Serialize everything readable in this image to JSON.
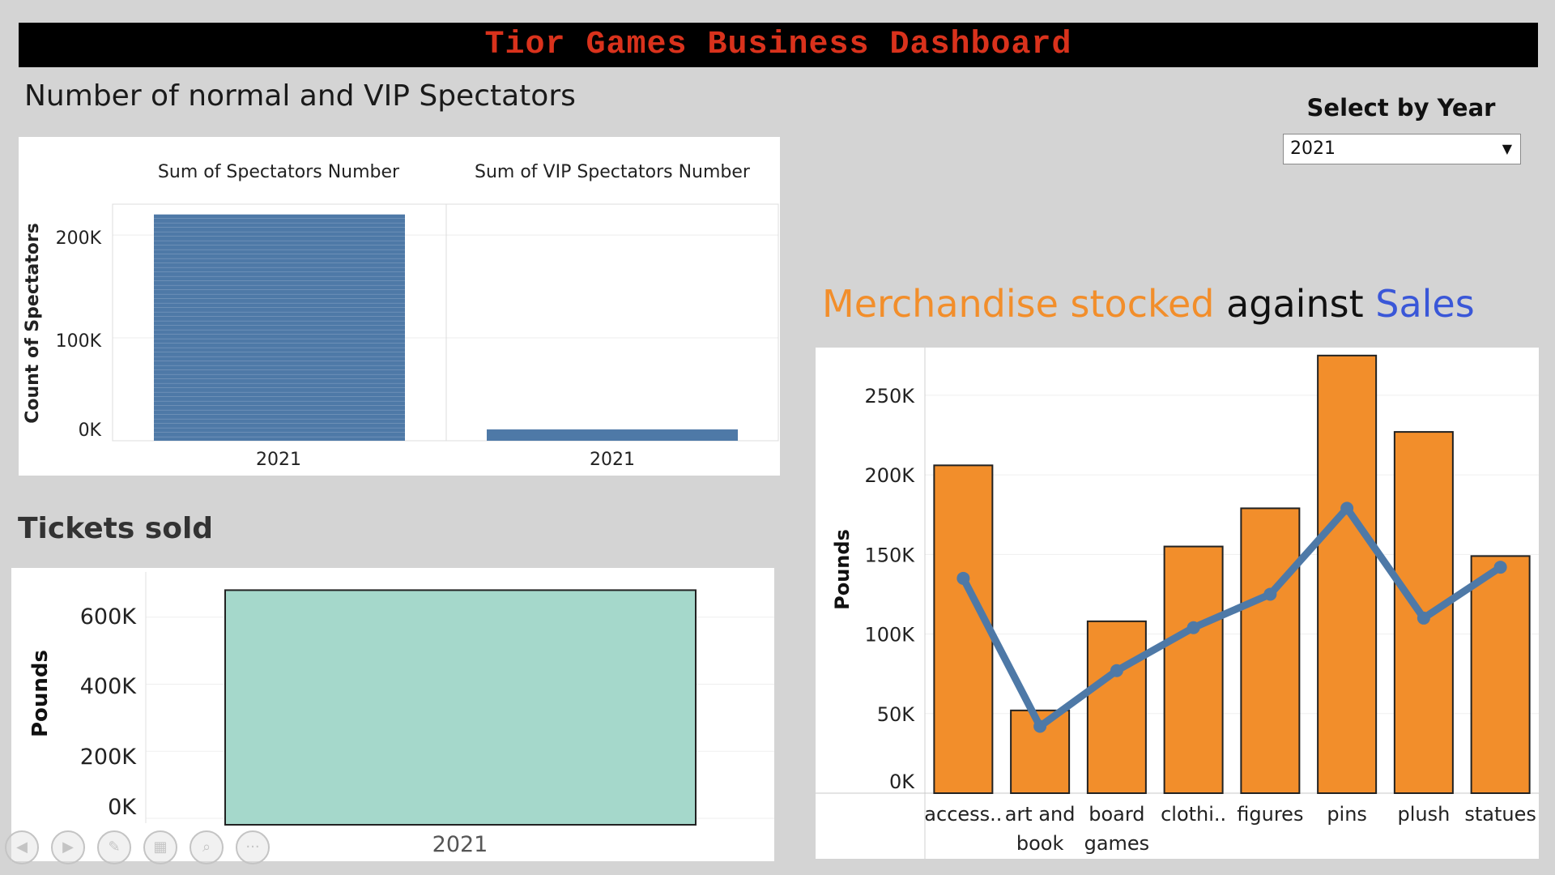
{
  "title": "Tior Games Business Dashboard",
  "spectators": {
    "section_title": "Number of normal and VIP Spectators",
    "y_axis_label": "Count of Spectators"
  },
  "tickets": {
    "section_title": "Tickets sold",
    "y_axis_label": "Pounds"
  },
  "merch": {
    "title_part1": "Merchandise stocked",
    "title_part2": " against ",
    "title_part3": "Sales",
    "y_axis_label": "Pounds"
  },
  "year_filter": {
    "label": "Select by Year",
    "selected": "2021"
  },
  "colors": {
    "title_red": "#d9321c",
    "spectators_bar": "#4e79a7",
    "tickets_bar": "#a5d8cb",
    "merch_stock": "#f28e2b",
    "merch_sales_line": "#4e79a7",
    "title_orange": "#f28e2b",
    "title_blue": "#3a57d8"
  },
  "toolbar_icons": [
    "back-icon",
    "forward-icon",
    "pen-icon",
    "layout-icon",
    "zoom-icon",
    "more-icon"
  ],
  "chart_data": [
    {
      "type": "bar",
      "name": "spectators",
      "panels": [
        "Sum of Spectators Number",
        "Sum of VIP Spectators Number"
      ],
      "categories": [
        "2021"
      ],
      "series": [
        {
          "name": "Sum of Spectators Number",
          "values": [
            220000
          ]
        },
        {
          "name": "Sum of VIP Spectators Number",
          "values": [
            11000
          ]
        }
      ],
      "ylabel": "Count of Spectators",
      "yticks": [
        "200K",
        "100K",
        "0K"
      ],
      "ylim": [
        0,
        230000
      ]
    },
    {
      "type": "bar",
      "name": "tickets",
      "categories": [
        "2021"
      ],
      "values": [
        695000
      ],
      "ylabel": "Pounds",
      "yticks": [
        "600K",
        "400K",
        "200K",
        "0K"
      ],
      "ylim": [
        0,
        725000
      ]
    },
    {
      "type": "bar",
      "name": "merchandise",
      "categories": [
        "access..",
        "art and book",
        "board games",
        "clothi..",
        "figures",
        "pins",
        "plush",
        "statues"
      ],
      "series": [
        {
          "name": "Merchandise stocked",
          "type": "bar",
          "values": [
            206000,
            52000,
            108000,
            155000,
            179000,
            275000,
            227000,
            149000
          ]
        },
        {
          "name": "Sales",
          "type": "line",
          "values": [
            135000,
            42000,
            77000,
            104000,
            125000,
            179000,
            110000,
            142000
          ]
        }
      ],
      "ylabel": "Pounds",
      "yticks": [
        "250K",
        "200K",
        "150K",
        "100K",
        "50K",
        "0K"
      ],
      "ylim": [
        0,
        280000
      ]
    }
  ]
}
